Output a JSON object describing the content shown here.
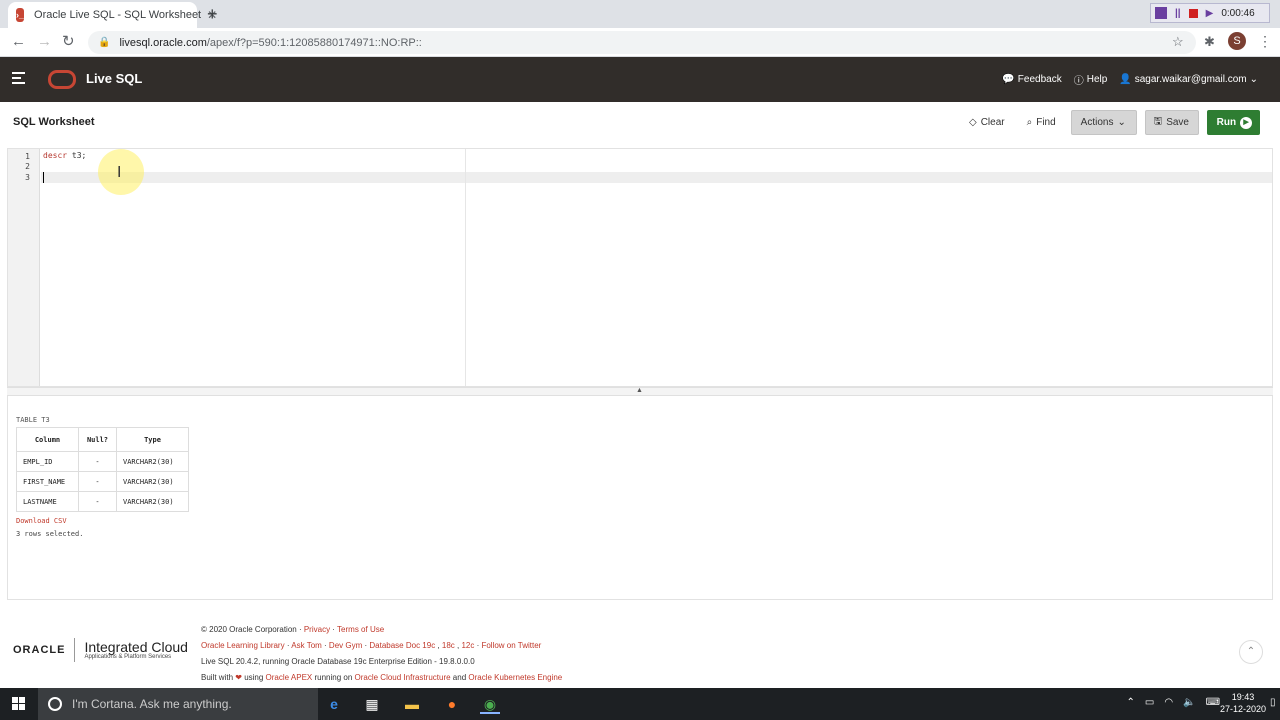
{
  "browser": {
    "tab_title": "Oracle Live SQL - SQL Worksheet",
    "url_host": "livesql.oracle.com",
    "url_path": "/apex/f?p=590:1:12085880174971::NO:RP::",
    "profile_initial": "S",
    "recording_time": "0:00:46"
  },
  "app": {
    "title": "Live SQL",
    "feedback": "Feedback",
    "help": "Help",
    "user": "sagar.waikar@gmail.com"
  },
  "worksheet": {
    "title": "SQL Worksheet",
    "clear": "Clear",
    "find": "Find",
    "actions": "Actions",
    "save": "Save",
    "run": "Run"
  },
  "editor": {
    "lines": [
      "1",
      "2",
      "3"
    ],
    "code_keyword": "descr",
    "code_rest": " t3;"
  },
  "results": {
    "caption": "TABLE T3",
    "headers": [
      "Column",
      "Null?",
      "Type"
    ],
    "rows": [
      [
        "EMPL_ID",
        "-",
        "VARCHAR2(30)"
      ],
      [
        "FIRST_NAME",
        "-",
        "VARCHAR2(30)"
      ],
      [
        "LASTNAME",
        "-",
        "VARCHAR2(30)"
      ]
    ],
    "download": "Download CSV",
    "rows_selected": "3 rows selected."
  },
  "footer": {
    "oracle": "ORACLE",
    "ic_title": "Integrated Cloud",
    "ic_sub": "Applications & Platform Services",
    "copyright": "© 2020 Oracle Corporation",
    "privacy": "Privacy",
    "terms": "Terms of Use",
    "links": [
      "Oracle Learning Library",
      "Ask Tom",
      "Dev Gym",
      "Database Doc 19c",
      "18c",
      "12c",
      "Follow on Twitter"
    ],
    "version": "Live SQL 20.4.2, running Oracle Database 19c Enterprise Edition - 19.8.0.0.0",
    "built_with": "Built with",
    "using": "using",
    "apex": "Oracle APEX",
    "running_on": "running on",
    "oci": "Oracle Cloud Infrastructure",
    "and": "and",
    "oke": "Oracle Kubernetes Engine"
  },
  "taskbar": {
    "cortana": "I'm Cortana. Ask me anything.",
    "time": "19:43",
    "date": "27-12-2020"
  },
  "colors": {
    "header_bg": "#312d2a",
    "oracle_red": "#c74634",
    "run_green": "#2e7d32"
  }
}
